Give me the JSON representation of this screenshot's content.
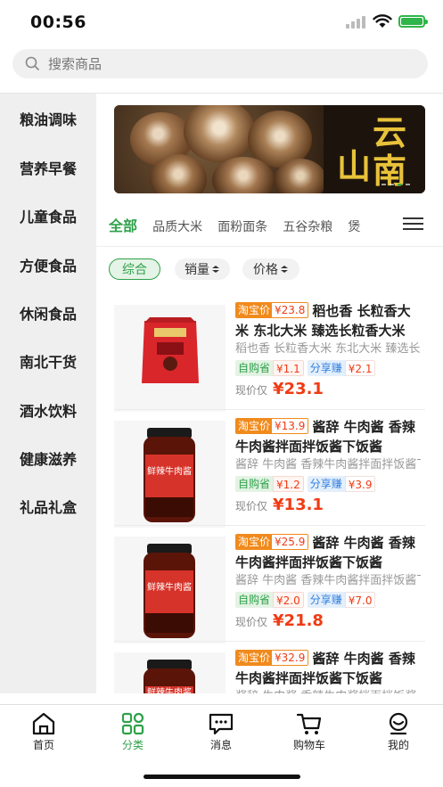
{
  "status_bar": {
    "time": "00:56"
  },
  "search": {
    "placeholder": "搜索商品"
  },
  "sidebar": {
    "items": [
      {
        "label": "粮油调味"
      },
      {
        "label": "营养早餐"
      },
      {
        "label": "儿童食品"
      },
      {
        "label": "方便食品"
      },
      {
        "label": "休闲食品"
      },
      {
        "label": "南北干货"
      },
      {
        "label": "酒水饮料"
      },
      {
        "label": "健康滋养"
      },
      {
        "label": "礼品礼盒"
      }
    ]
  },
  "banner": {
    "text_col1": "云南",
    "text_col2": "山茶"
  },
  "category_tabs": {
    "active": "全部",
    "items": [
      "全部",
      "品质大米",
      "面粉面条",
      "五谷杂粮",
      "煲"
    ]
  },
  "sort": {
    "overall": "综合",
    "sales": "销量",
    "price": "价格"
  },
  "products": [
    {
      "taobao_label": "淘宝价",
      "taobao_price": "¥23.8",
      "title": "稻也香 长粒香大米 东北大米 臻选长粒香大米",
      "subtitle": "稻也香 长粒香大米 东北大米 臻选长粒香",
      "save_label": "自购省",
      "save_value": "¥1.1",
      "share_label": "分享赚",
      "share_value": "¥2.1",
      "price_label": "现价仅",
      "price": "¥23.1",
      "image": "rice-bag"
    },
    {
      "taobao_label": "淘宝价",
      "taobao_price": "¥13.9",
      "title": "酱辞 牛肉酱 香辣牛肉酱拌面拌饭酱下饭酱",
      "subtitle": "酱辞 牛肉酱 香辣牛肉酱拌面拌饭酱下饭酱",
      "save_label": "自购省",
      "save_value": "¥1.2",
      "share_label": "分享赚",
      "share_value": "¥3.9",
      "price_label": "现价仅",
      "price": "¥13.1",
      "image": "sauce-jar",
      "jar_label": "鲜辣牛肉酱"
    },
    {
      "taobao_label": "淘宝价",
      "taobao_price": "¥25.9",
      "title": "酱辞 牛肉酱 香辣牛肉酱拌面拌饭酱下饭酱",
      "subtitle": "酱辞 牛肉酱 香辣牛肉酱拌面拌饭酱下饭酱",
      "save_label": "自购省",
      "save_value": "¥2.0",
      "share_label": "分享赚",
      "share_value": "¥7.0",
      "price_label": "现价仅",
      "price": "¥21.8",
      "image": "sauce-jar",
      "jar_label": "鲜辣牛肉酱"
    },
    {
      "taobao_label": "淘宝价",
      "taobao_price": "¥32.9",
      "title": "酱辞 牛肉酱 香辣牛肉酱拌面拌饭酱下饭酱",
      "subtitle": "酱辞 牛肉酱 香辣牛肉酱拌面拌饭酱",
      "image": "sauce-jar",
      "jar_label": "鲜辣牛肉酱"
    }
  ],
  "bottom_nav": {
    "items": [
      {
        "label": "首页",
        "icon": "home-icon"
      },
      {
        "label": "分类",
        "icon": "category-grid-icon",
        "active": true
      },
      {
        "label": "消息",
        "icon": "message-icon"
      },
      {
        "label": "购物车",
        "icon": "cart-icon"
      },
      {
        "label": "我的",
        "icon": "profile-icon"
      }
    ]
  },
  "colors": {
    "accent_green": "#2fa14a",
    "price_red": "#f03b14",
    "taobao_orange": "#f08a1c",
    "share_blue": "#2f7fe0"
  }
}
